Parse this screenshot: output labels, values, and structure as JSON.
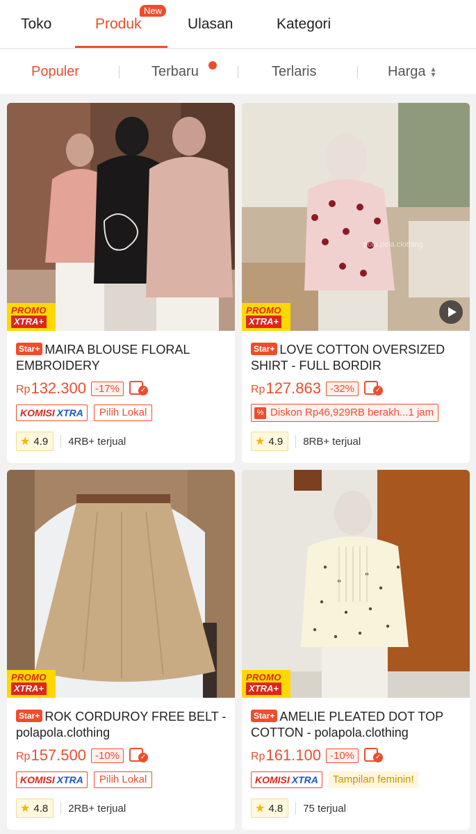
{
  "tabs": [
    {
      "label": "Toko"
    },
    {
      "label": "Produk",
      "badge": "New"
    },
    {
      "label": "Ulasan"
    },
    {
      "label": "Kategori"
    }
  ],
  "sort": {
    "populer": "Populer",
    "terbaru": "Terbaru",
    "terlaris": "Terlaris",
    "harga": "Harga"
  },
  "common": {
    "promo_top": "PROMO",
    "promo_bottom": "XTRA+",
    "star_badge": "Star+",
    "rp": "Rp",
    "komisi_1": "KOMISI",
    "komisi_2": "XTRA"
  },
  "products": [
    {
      "title": "MAIRA BLOUSE FLORAL EMBROIDERY",
      "price": "132.300",
      "discount": "-17%",
      "tag": "Pilih Lokal",
      "rating": "4.9",
      "sold": "4RB+ terjual"
    },
    {
      "title": "LOVE COTTON OVERSIZED SHIRT - FULL BORDIR",
      "price": "127.863",
      "discount": "-32%",
      "tag": "Diskon Rp46,929RB berakh...1 jam",
      "rating": "4.9",
      "sold": "8RB+ terjual",
      "watermark": "pola.pola.clothing"
    },
    {
      "title": "ROK CORDUROY FREE BELT - polapola.clothing",
      "price": "157.500",
      "discount": "-10%",
      "tag": "Pilih Lokal",
      "rating": "4.8",
      "sold": "2RB+ terjual"
    },
    {
      "title": "AMELIE PLEATED DOT TOP COTTON - polapola.clothing",
      "price": "161.100",
      "discount": "-10%",
      "tag": "Tampilan feminin!",
      "rating": "4.8",
      "sold": "75 terjual"
    }
  ],
  "colors": {
    "accent": "#ee4d2d",
    "promo_yellow": "#ffd800",
    "komisi_blue": "#1a56c9",
    "star": "#f5b400"
  }
}
